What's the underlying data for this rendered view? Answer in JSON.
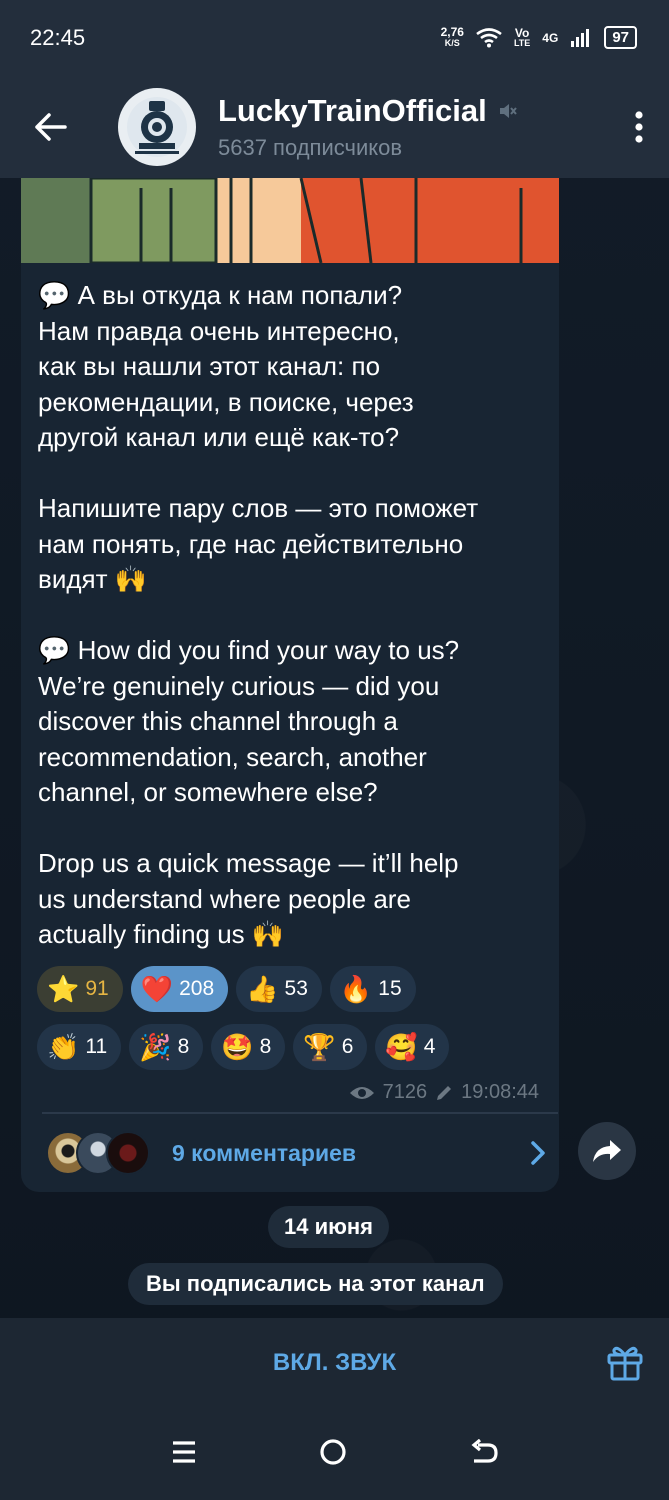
{
  "status_bar": {
    "time": "22:45",
    "net_speed_value": "2,76",
    "net_speed_unit": "K/S",
    "volte_top": "Vo",
    "volte_bottom": "LTE",
    "network": "4G",
    "battery": "97"
  },
  "header": {
    "channel_name": "LuckyTrainOfficial",
    "subscribers": "5637 подписчиков"
  },
  "message": {
    "text": "💬 А вы откуда к нам попали?\nНам правда очень интересно,\nкак вы нашли этот канал: по\nрекомендации, в поиске, через\nдругой канал или ещё как-то?\n\nНапишите пару слов — это поможет\nнам понять, где нас действительно\nвидят 🙌\n\n💬 How did you find your way to us?\nWe’re genuinely curious — did you\ndiscover this channel through a\nrecommendation, search, another\nchannel, or somewhere else?\n\nDrop us a quick message — it’ll help\nus understand where people are\nactually finding us 🙌",
    "views": "7126",
    "time": "19:08:44",
    "comments_label": "9 комментариев"
  },
  "reactions": {
    "row1": [
      {
        "emoji": "⭐",
        "count": "91",
        "style": "gold"
      },
      {
        "emoji": "❤️",
        "count": "208",
        "style": "active"
      },
      {
        "emoji": "👍",
        "count": "53",
        "style": ""
      },
      {
        "emoji": "🔥",
        "count": "15",
        "style": ""
      }
    ],
    "row2": [
      {
        "emoji": "👏",
        "count": "11",
        "style": ""
      },
      {
        "emoji": "🎉",
        "count": "8",
        "style": ""
      },
      {
        "emoji": "🤩",
        "count": "8",
        "style": ""
      },
      {
        "emoji": "🏆",
        "count": "6",
        "style": ""
      },
      {
        "emoji": "🥰",
        "count": "4",
        "style": ""
      }
    ]
  },
  "date_divider": "14 июня",
  "service_message": "Вы подписались на этот канал",
  "bottom_bar": {
    "unmute_label": "ВКЛ. ЗВУК"
  },
  "colors": {
    "accent": "#5ea9e6",
    "header_bg": "#232e3c",
    "bubble_bg": "#182533",
    "reaction_active": "#5b94c9"
  }
}
